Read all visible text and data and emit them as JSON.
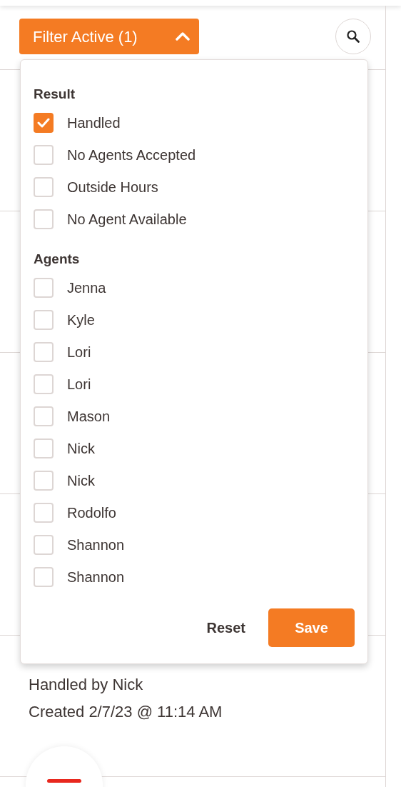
{
  "filter_button": {
    "label": "Filter Active (1)",
    "expanded": true
  },
  "filter_panel": {
    "sections": [
      {
        "heading": "Result",
        "options": [
          {
            "label": "Handled",
            "checked": true
          },
          {
            "label": "No Agents Accepted",
            "checked": false
          },
          {
            "label": "Outside Hours",
            "checked": false
          },
          {
            "label": "No Agent Available",
            "checked": false
          }
        ]
      },
      {
        "heading": "Agents",
        "options": [
          {
            "label": "Jenna",
            "checked": false
          },
          {
            "label": "Kyle",
            "checked": false
          },
          {
            "label": "Lori",
            "checked": false
          },
          {
            "label": "Lori",
            "checked": false
          },
          {
            "label": "Mason",
            "checked": false
          },
          {
            "label": "Nick",
            "checked": false
          },
          {
            "label": "Nick",
            "checked": false
          },
          {
            "label": "Rodolfo",
            "checked": false
          },
          {
            "label": "Shannon",
            "checked": false
          },
          {
            "label": "Shannon",
            "checked": false
          }
        ]
      }
    ],
    "buttons": {
      "reset": "Reset",
      "save": "Save"
    }
  },
  "record": {
    "handled_by": "Handled by Nick",
    "created": "Created 2/7/23 @ 11:14 AM"
  }
}
